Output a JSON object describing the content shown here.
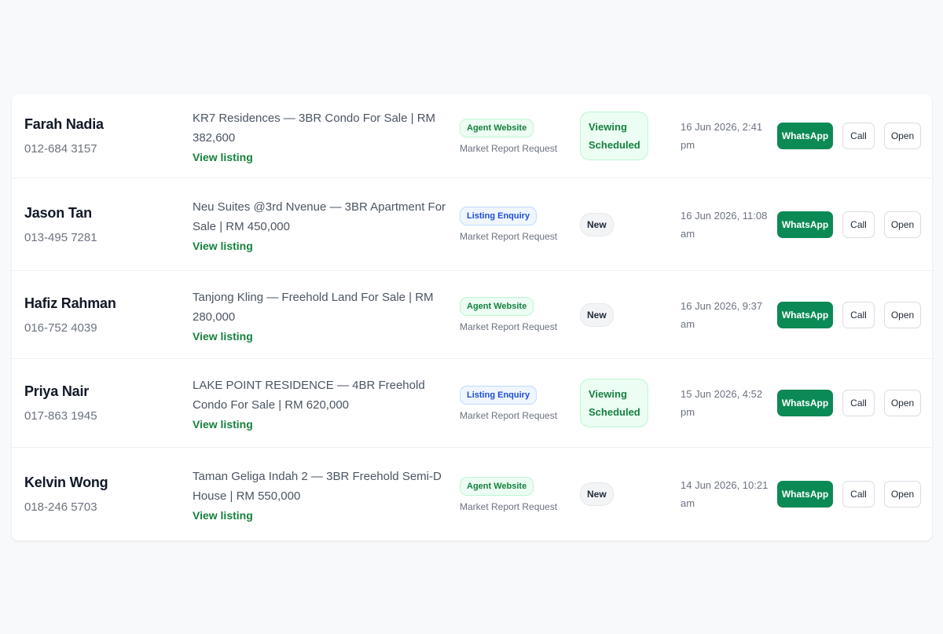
{
  "leads": [
    {
      "name": "Farah Nadia",
      "phone": "012-684 3157",
      "listing": "KR7 Residences — 3BR Condo For Sale | RM 382,600",
      "view_link": "View listing",
      "source": "Agent Website",
      "source_type": "green",
      "source_sub": "Market Report Request",
      "status": "Viewing Scheduled",
      "status_type": "viewing",
      "date": "16 Jun 2026, 2:41 pm",
      "actions": {
        "whatsapp": "WhatsApp",
        "call": "Call",
        "open": "Open"
      }
    },
    {
      "name": "Jason Tan",
      "phone": "013-495 7281",
      "listing": "Neu Suites @3rd Nvenue — 3BR Apartment For Sale | RM 450,000",
      "view_link": "View listing",
      "source": "Listing Enquiry",
      "source_type": "blue",
      "source_sub": "Market Report Request",
      "status": "New",
      "status_type": "new",
      "date": "16 Jun 2026, 11:08 am",
      "actions": {
        "whatsapp": "WhatsApp",
        "call": "Call",
        "open": "Open"
      }
    },
    {
      "name": "Hafiz Rahman",
      "phone": "016-752 4039",
      "listing": "Tanjong Kling — Freehold Land For Sale | RM 280,000",
      "view_link": "View listing",
      "source": "Agent Website",
      "source_type": "green",
      "source_sub": "Market Report Request",
      "status": "New",
      "status_type": "new",
      "date": "16 Jun 2026, 9:37 am",
      "actions": {
        "whatsapp": "WhatsApp",
        "call": "Call",
        "open": "Open"
      }
    },
    {
      "name": "Priya Nair",
      "phone": "017-863 1945",
      "listing": "LAKE POINT RESIDENCE — 4BR Freehold Condo For Sale | RM 620,000",
      "view_link": "View listing",
      "source": "Listing Enquiry",
      "source_type": "blue",
      "source_sub": "Market Report Request",
      "status": "Viewing Scheduled",
      "status_type": "viewing",
      "date": "15 Jun 2026, 4:52 pm",
      "actions": {
        "whatsapp": "WhatsApp",
        "call": "Call",
        "open": "Open"
      }
    },
    {
      "name": "Kelvin Wong",
      "phone": "018-246 5703",
      "listing": "Taman Geliga Indah 2 — 3BR Freehold Semi-D House | RM 550,000",
      "view_link": "View listing",
      "source": "Agent Website",
      "source_type": "green",
      "source_sub": "Market Report Request",
      "status": "New",
      "status_type": "new",
      "date": "14 Jun 2026, 10:21 am",
      "actions": {
        "whatsapp": "WhatsApp",
        "call": "Call",
        "open": "Open"
      }
    }
  ],
  "colors": {
    "page_bg": "#f8f9fb",
    "whatsapp": "#0b8a55",
    "link": "#15803d",
    "source_green": "#15803d",
    "source_blue": "#1d4ed8"
  }
}
